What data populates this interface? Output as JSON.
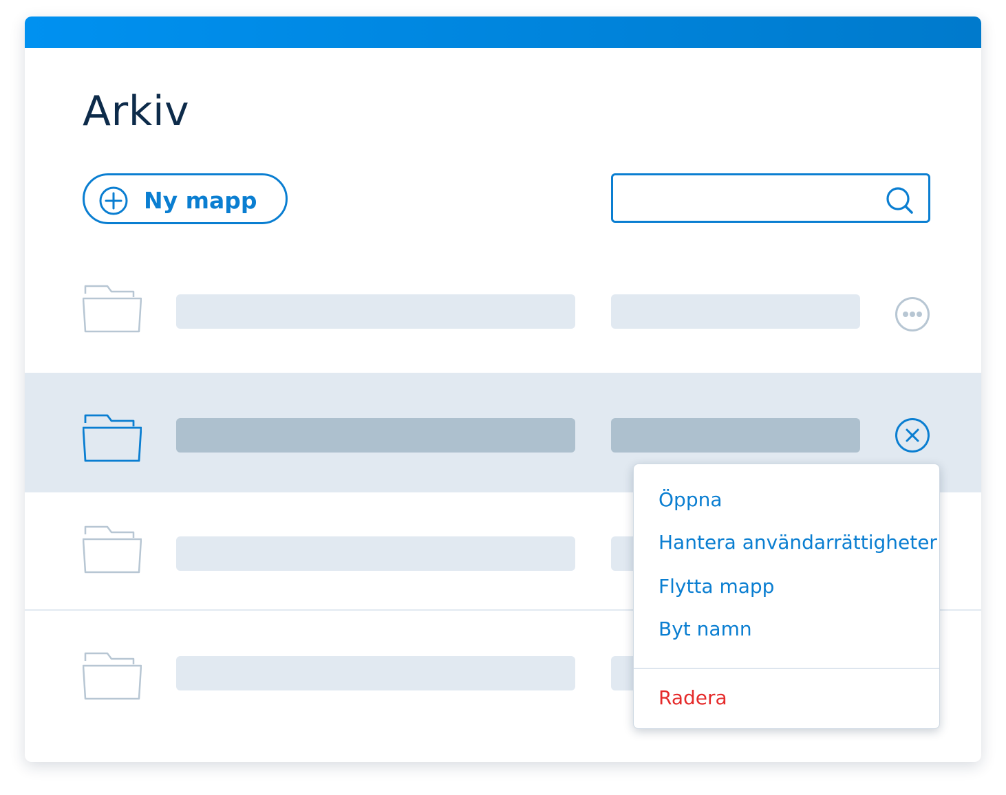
{
  "page": {
    "title": "Arkiv"
  },
  "toolbar": {
    "new_folder_label": "Ny mapp",
    "search_value": "",
    "search_placeholder": ""
  },
  "context_menu": {
    "items": [
      {
        "label": "Öppna"
      },
      {
        "label": "Hantera användarrättigheter"
      },
      {
        "label": "Flytta mapp"
      },
      {
        "label": "Byt namn"
      }
    ],
    "delete_label": "Radera"
  },
  "colors": {
    "accent": "#0a7ed1",
    "topbar_start": "#0091f0",
    "topbar_end": "#007acc",
    "title": "#0d2b4a",
    "placeholder": "#e1e9f1",
    "placeholder_selected": "#adc0ce",
    "icon_muted": "#b7c6d3",
    "danger": "#e52a2a"
  },
  "icons": {
    "new_folder": "plus-circle-icon",
    "search": "search-icon",
    "folder": "folder-icon",
    "more": "more-horizontal-icon",
    "close": "close-circle-icon"
  }
}
